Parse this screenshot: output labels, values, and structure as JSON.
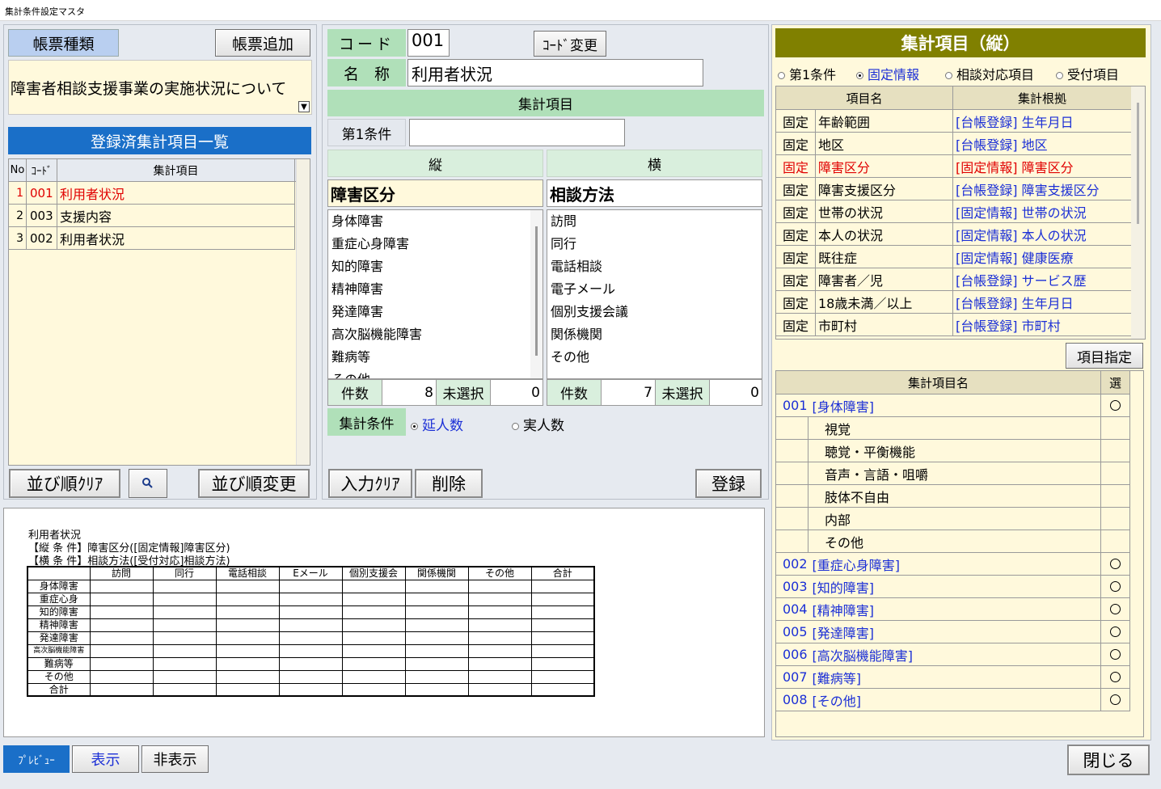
{
  "window_title": "集計条件設定マスタ",
  "left": {
    "report_type_label": "帳票種類",
    "add_report_button": "帳票追加",
    "report_name": "障害者相談支援事業の実施状況について",
    "registered_header": "登録済集計項目一覧",
    "columns": [
      "No",
      "ｺｰﾄﾞ",
      "集計項目"
    ],
    "rows": [
      {
        "no": "1",
        "code": "001",
        "item": "利用者状況"
      },
      {
        "no": "2",
        "code": "003",
        "item": "支援内容"
      },
      {
        "no": "3",
        "code": "002",
        "item": "利用者状況"
      }
    ],
    "sort_clear_button": "並び順ｸﾘｱ",
    "sort_change_button": "並び順変更"
  },
  "middle": {
    "code_label": "コード",
    "code_value": "001",
    "code_change_button": "ｺｰﾄﾞ変更",
    "name_label": "名　称",
    "name_value": "利用者状況",
    "agg_items_header": "集計項目",
    "cond1_label": "第1条件",
    "cond1_value": "",
    "vertical_header": "縦",
    "horizontal_header": "横",
    "vertical_title": "障害区分",
    "horizontal_title": "相談方法",
    "vertical_items": [
      "身体障害",
      "重症心身障害",
      "知的障害",
      "精神障害",
      "発達障害",
      "高次脳機能障害",
      "難病等",
      "その他"
    ],
    "horizontal_items": [
      "訪問",
      "同行",
      "電話相談",
      "電子メール",
      "個別支援会議",
      "関係機関",
      "その他"
    ],
    "count_label": "件数",
    "unselected_label": "未選択",
    "vertical_count": "8",
    "vertical_unselected": "0",
    "horizontal_count": "7",
    "horizontal_unselected": "0",
    "agg_cond_label": "集計条件",
    "radio_total": "延人数",
    "radio_real": "実人数",
    "input_clear_button": "入力ｸﾘｱ",
    "delete_button": "削除",
    "register_button": "登録"
  },
  "right": {
    "header": "集計項目（縦）",
    "radios": [
      "第1条件",
      "固定情報",
      "相談対応項目",
      "受付項目"
    ],
    "selected_radio": "固定情報",
    "columns": [
      "項目名",
      "集計根拠"
    ],
    "rows": [
      {
        "type": "固定",
        "name": "年齢範囲",
        "basis": "[台帳登録] 生年月日",
        "hl": false
      },
      {
        "type": "固定",
        "name": "地区",
        "basis": "[台帳登録] 地区",
        "hl": false
      },
      {
        "type": "固定",
        "name": "障害区分",
        "basis": "[固定情報] 障害区分",
        "hl": true
      },
      {
        "type": "固定",
        "name": "障害支援区分",
        "basis": "[台帳登録] 障害支援区分",
        "hl": false
      },
      {
        "type": "固定",
        "name": "世帯の状況",
        "basis": "[固定情報] 世帯の状況",
        "hl": false
      },
      {
        "type": "固定",
        "name": "本人の状況",
        "basis": "[固定情報] 本人の状況",
        "hl": false
      },
      {
        "type": "固定",
        "name": "既往症",
        "basis": "[固定情報] 健康医療",
        "hl": false
      },
      {
        "type": "固定",
        "name": "障害者／児",
        "basis": "[台帳登録] サービス歴",
        "hl": false
      },
      {
        "type": "固定",
        "name": "18歳未満／以上",
        "basis": "[台帳登録] 生年月日",
        "hl": false
      },
      {
        "type": "固定",
        "name": "市町村",
        "basis": "[台帳登録] 市町村",
        "hl": false
      }
    ],
    "item_specify_button": "項目指定",
    "sub_columns": [
      "集計項目名",
      "選"
    ],
    "sub_rows": [
      {
        "code": "001",
        "name": "[身体障害]",
        "child": false,
        "sel": true
      },
      {
        "code": "",
        "name": "視覚",
        "child": true,
        "sel": false
      },
      {
        "code": "",
        "name": "聴覚・平衡機能",
        "child": true,
        "sel": false
      },
      {
        "code": "",
        "name": "音声・言語・咀嚼",
        "child": true,
        "sel": false
      },
      {
        "code": "",
        "name": "肢体不自由",
        "child": true,
        "sel": false
      },
      {
        "code": "",
        "name": "内部",
        "child": true,
        "sel": false
      },
      {
        "code": "",
        "name": "その他",
        "child": true,
        "sel": false
      },
      {
        "code": "002",
        "name": "[重症心身障害]",
        "child": false,
        "sel": true
      },
      {
        "code": "003",
        "name": "[知的障害]",
        "child": false,
        "sel": true
      },
      {
        "code": "004",
        "name": "[精神障害]",
        "child": false,
        "sel": true
      },
      {
        "code": "005",
        "name": "[発達障害]",
        "child": false,
        "sel": true
      },
      {
        "code": "006",
        "name": "[高次脳機能障害]",
        "child": false,
        "sel": true
      },
      {
        "code": "007",
        "name": "[難病等]",
        "child": false,
        "sel": true
      },
      {
        "code": "008",
        "name": "[その他]",
        "child": false,
        "sel": true
      }
    ]
  },
  "preview": {
    "title": "利用者状況",
    "vertical_cond": "【縦 条 件】障害区分([固定情報]障害区分)",
    "horizontal_cond": "【横 条 件】相談方法([受付対応]相談方法)",
    "col_headers": [
      "訪問",
      "同行",
      "電話相談",
      "Eメール",
      "個別支援会",
      "関係機関",
      "その他",
      "合計"
    ],
    "row_headers": [
      "身体障害",
      "重症心身",
      "知的障害",
      "精神障害",
      "発達障害",
      "高次脳機能障害",
      "難病等",
      "その他",
      "合計"
    ]
  },
  "footer": {
    "preview_label": "ﾌﾟﾚﾋﾞｭｰ",
    "show_button": "表示",
    "hide_button": "非表示",
    "close_button": "閉じる"
  },
  "colors": {
    "accent_blue": "#1a6fc8",
    "header_olive": "#808000",
    "label_green": "#b0e0b9",
    "cream": "#fff9dc",
    "highlight_red": "#e00000",
    "link_blue": "#1b2fd6"
  }
}
